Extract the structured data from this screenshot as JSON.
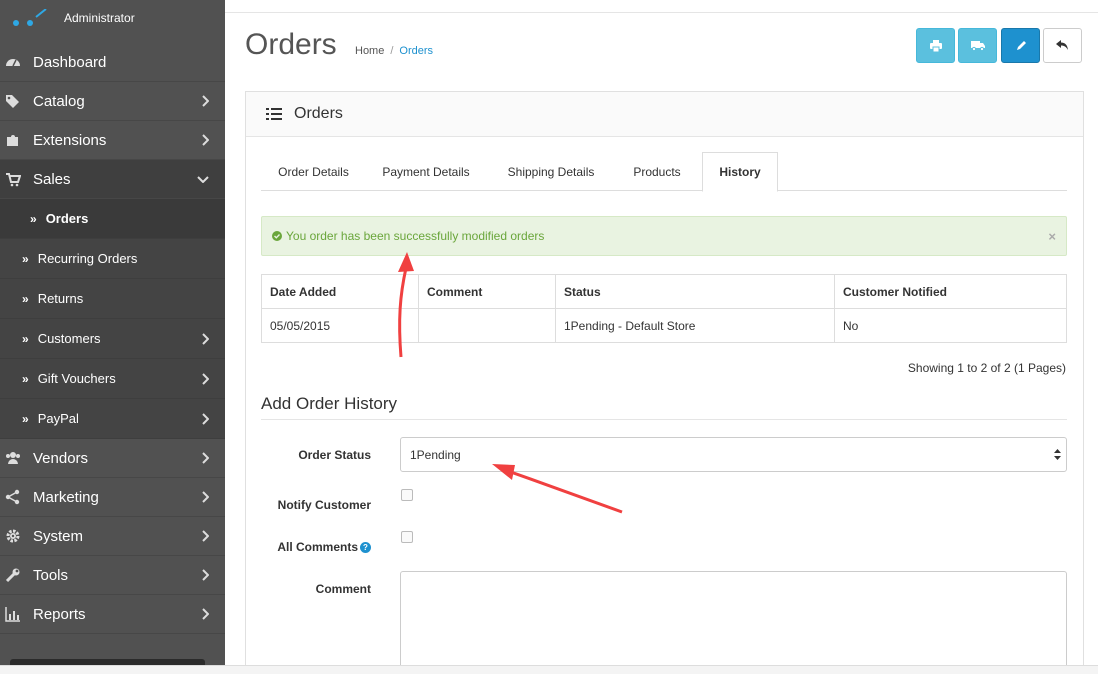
{
  "sidebar": {
    "role": "Administrator",
    "items": [
      {
        "label": "Dashboard",
        "icon": "dashboard-icon"
      },
      {
        "label": "Catalog",
        "icon": "tags-icon"
      },
      {
        "label": "Extensions",
        "icon": "puzzle-icon"
      },
      {
        "label": "Sales",
        "icon": "shopping-cart-icon"
      },
      {
        "label": "Vendors",
        "icon": "users-icon"
      },
      {
        "label": "Marketing",
        "icon": "share-icon"
      },
      {
        "label": "System",
        "icon": "cog-icon"
      },
      {
        "label": "Tools",
        "icon": "wrench-icon"
      },
      {
        "label": "Reports",
        "icon": "bar-chart-icon"
      }
    ],
    "sales_sub": [
      {
        "label": "Orders"
      },
      {
        "label": "Recurring Orders"
      },
      {
        "label": "Returns"
      },
      {
        "label": "Customers"
      },
      {
        "label": "Gift Vouchers"
      },
      {
        "label": "PayPal"
      }
    ]
  },
  "header": {
    "title": "Orders",
    "breadcrumb": [
      "Home",
      "Orders"
    ],
    "buttons": [
      "print-icon",
      "truck-icon",
      "pencil-icon",
      "reply-icon"
    ]
  },
  "panel": {
    "title": "Orders",
    "tabs": [
      "Order Details",
      "Payment Details",
      "Shipping Details",
      "Products",
      "History"
    ],
    "active_tab": "History",
    "alert": "You order has been successfully modified orders",
    "alert_close": "×",
    "table": {
      "headers": [
        "Date Added",
        "Comment",
        "Status",
        "Customer Notified"
      ],
      "rows": [
        [
          "05/05/2015",
          "",
          "1Pending - Default Store",
          "No"
        ]
      ]
    },
    "pagination": "Showing 1 to 2 of 2 (1 Pages)",
    "form": {
      "legend": "Add Order History",
      "order_status_label": "Order Status",
      "order_status_value": "1Pending",
      "notify_label": "Notify Customer",
      "all_comments_label": "All Comments",
      "comment_label": "Comment",
      "help": "?"
    }
  },
  "colors": {
    "sidebar_bg": "#515151",
    "primary": "#1e91cf",
    "info": "#5bc0de",
    "success_bg": "#e9f3e1",
    "success_text": "#6aa63b",
    "annotation_arrow": "#f04040"
  }
}
